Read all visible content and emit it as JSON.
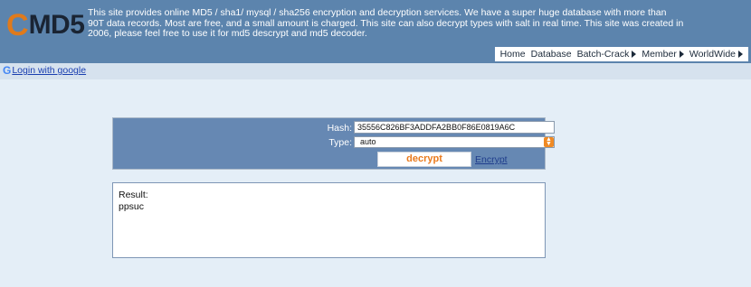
{
  "header": {
    "logo_c": "C",
    "logo_md5": "MD5",
    "description": "This site provides online MD5 / sha1/ mysql / sha256 encryption and decryption services. We have a super huge database with more than 90T data records. Most are free, and a small amount is charged. This site can also decrypt types with salt in real time. This site was created in 2006, please feel free to use it for md5 descrypt and md5 decoder.",
    "nav": {
      "home": "Home",
      "database": "Database",
      "batch_crack": "Batch-Crack",
      "member": "Member",
      "worldwide": "WorldWide"
    }
  },
  "login": {
    "icon_letter": "G",
    "label": "Login with google"
  },
  "form": {
    "hash_label": "Hash:",
    "hash_value": "35556C826BF3ADDFA2BB0F86E0819A6C",
    "type_label": "Type:",
    "type_value": "auto",
    "decrypt_label": "decrypt",
    "encrypt_label": "Encrypt"
  },
  "result": {
    "label": "Result:",
    "value": "ppsuc"
  },
  "colors": {
    "header_bg": "#5c84ad",
    "panel_bg": "#6688b3",
    "page_bg": "#e4eef7",
    "accent": "#ea7a1c"
  },
  "icons": {
    "google": "google-icon",
    "nav_arrow": "triangle-right-icon",
    "select_arrow": "updown-arrow-icon"
  }
}
